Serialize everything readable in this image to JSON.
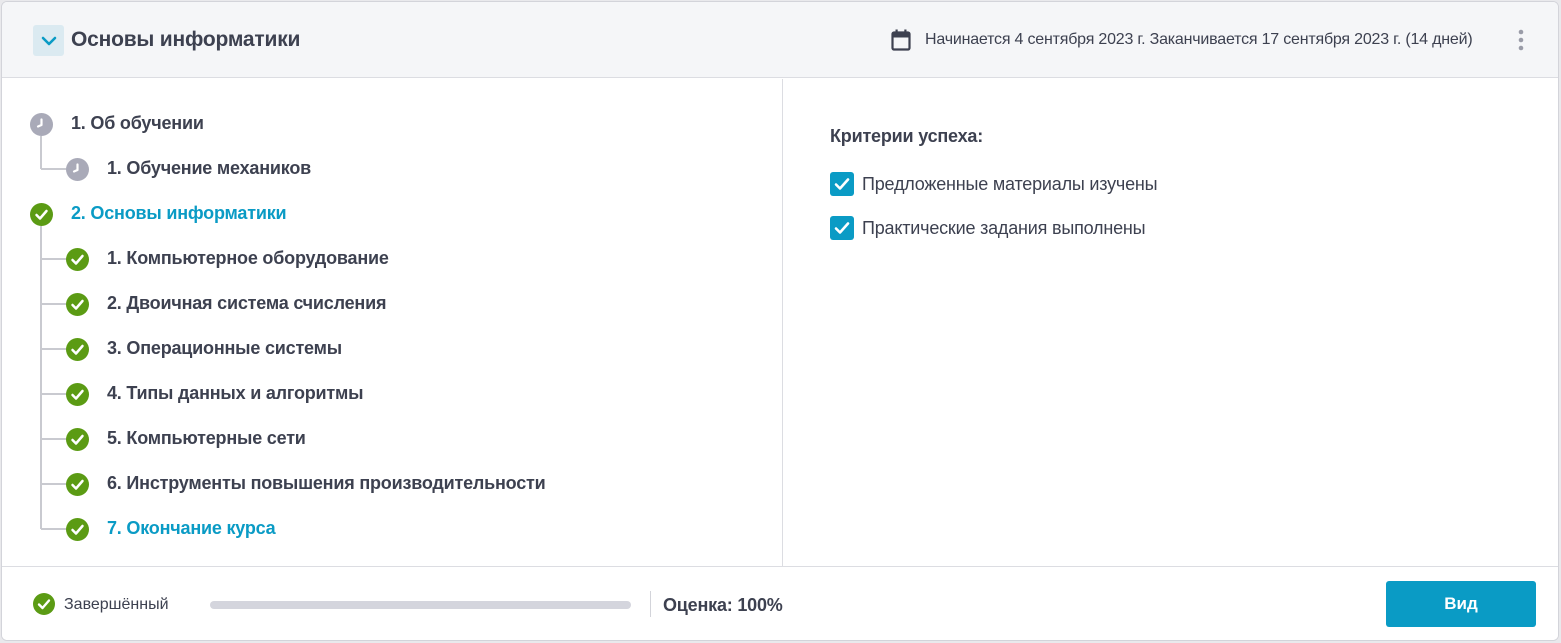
{
  "header": {
    "title": "Основы информатики",
    "dates": "Начинается 4 сентября 2023 г. Заканчивается 17 сентября 2023 г. (14 дней)",
    "collapse_icon": "chevron-down-icon",
    "calendar_icon": "calendar-icon",
    "more_icon": "more-vertical-icon"
  },
  "tree": [
    {
      "label": "1. Об обучении",
      "level": 0,
      "status": "pending",
      "active": false
    },
    {
      "label": "1. Обучение механиков",
      "level": 1,
      "status": "pending",
      "active": false
    },
    {
      "label": "2. Основы информатики",
      "level": 0,
      "status": "done",
      "active": true
    },
    {
      "label": "1. Компьютерное оборудование",
      "level": 1,
      "status": "done",
      "active": false
    },
    {
      "label": "2. Двоичная система счисления",
      "level": 1,
      "status": "done",
      "active": false
    },
    {
      "label": "3. Операционные системы",
      "level": 1,
      "status": "done",
      "active": false
    },
    {
      "label": "4. Типы данных и алгоритмы",
      "level": 1,
      "status": "done",
      "active": false
    },
    {
      "label": "5. Компьютерные сети",
      "level": 1,
      "status": "done",
      "active": false
    },
    {
      "label": "6. Инструменты повышения производительности",
      "level": 1,
      "status": "done",
      "active": false
    },
    {
      "label": "7. Окончание курса",
      "level": 1,
      "status": "done",
      "active": true
    }
  ],
  "criteria": {
    "title": "Критерии успеха:",
    "items": [
      {
        "label": "Предложенные материалы изучены",
        "checked": true
      },
      {
        "label": "Практические задания выполнены",
        "checked": true
      }
    ]
  },
  "footer": {
    "status": "Завершённый",
    "progress": 1.0,
    "score": "Оценка: 100%",
    "view_button": "Вид"
  },
  "colors": {
    "accent": "#0a9bc5",
    "done": "#5b9b14",
    "pending": "#a9aab8",
    "text": "#3d4150"
  }
}
